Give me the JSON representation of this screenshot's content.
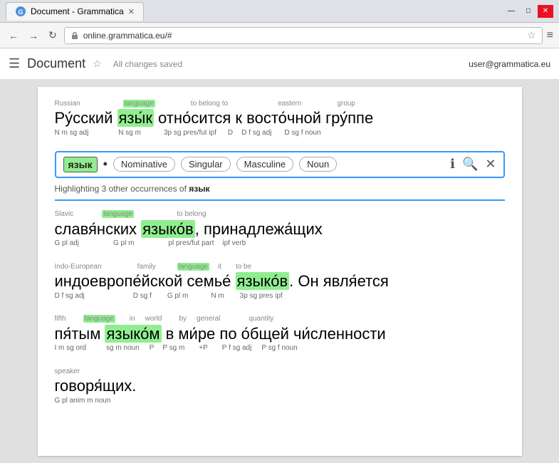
{
  "browser": {
    "tab_title": "Document - Grammatica",
    "url": "online.grammatica.eu/#",
    "window_title": "Document - Grammatica",
    "back_btn": "←",
    "forward_btn": "→",
    "reload_btn": "↻",
    "star_btn": "☆",
    "menu_btn": "≡"
  },
  "toolbar": {
    "hamburger": "☰",
    "doc_title": "Document",
    "star": "☆",
    "saved_status": "All changes saved",
    "user_email": "user@grammatica.eu"
  },
  "popup": {
    "word": "язык",
    "dot": "•",
    "tags": [
      "Nominative",
      "Singular",
      "Masculine",
      "Noun"
    ],
    "highlight_note": "Highlighting 3 other occurrences of",
    "highlight_word": "язык"
  },
  "sentences": [
    {
      "id": "s1",
      "top_labels": [
        "Russian",
        "language",
        "",
        "to belong to",
        "",
        "eastern",
        "",
        "group"
      ],
      "main_text": "Ру́сский язы́к отно́сится к восто́чной гру́ппе",
      "bot_labels": [
        "N m sg adj",
        "N sg m",
        "3p sg pres/fut ipf",
        "D",
        "D f sg adj",
        "D sg f noun"
      ]
    },
    {
      "id": "s2",
      "top_labels": [
        "Slavic",
        "",
        "language",
        "",
        "",
        "",
        "to belong"
      ],
      "main_text": "славя́нских языко́в, принадлежа́щих",
      "bot_labels": [
        "G pl adj",
        "G pl m",
        "pl pres/fut part",
        "ipf verb"
      ]
    },
    {
      "id": "s3",
      "top_labels": [
        "Indo-European",
        "",
        "family",
        "",
        "language",
        "",
        "it",
        "",
        "to be"
      ],
      "main_text": "индоевропе́йской семье́ языко́в. Он явля́ется",
      "bot_labels": [
        "D f sg adj",
        "",
        "D sg f",
        "G pl m",
        "N m",
        "3p sg pres ipf"
      ]
    },
    {
      "id": "s4",
      "top_labels": [
        "fifth",
        "",
        "language",
        "in",
        "world",
        "by",
        "general",
        "",
        "quantity"
      ],
      "main_text": "пя́тым языко́м в ми́ре по о́бщей чи́сленности",
      "bot_labels": [
        "I m sg ord",
        "sg m noun",
        "P",
        "P sg m",
        "+P",
        "P f sg adj",
        "P sg f noun"
      ]
    },
    {
      "id": "s5",
      "top_labels": [
        "speaker"
      ],
      "main_text": "говоря́щих.",
      "bot_labels": [
        "G pl anim m noun"
      ]
    }
  ]
}
